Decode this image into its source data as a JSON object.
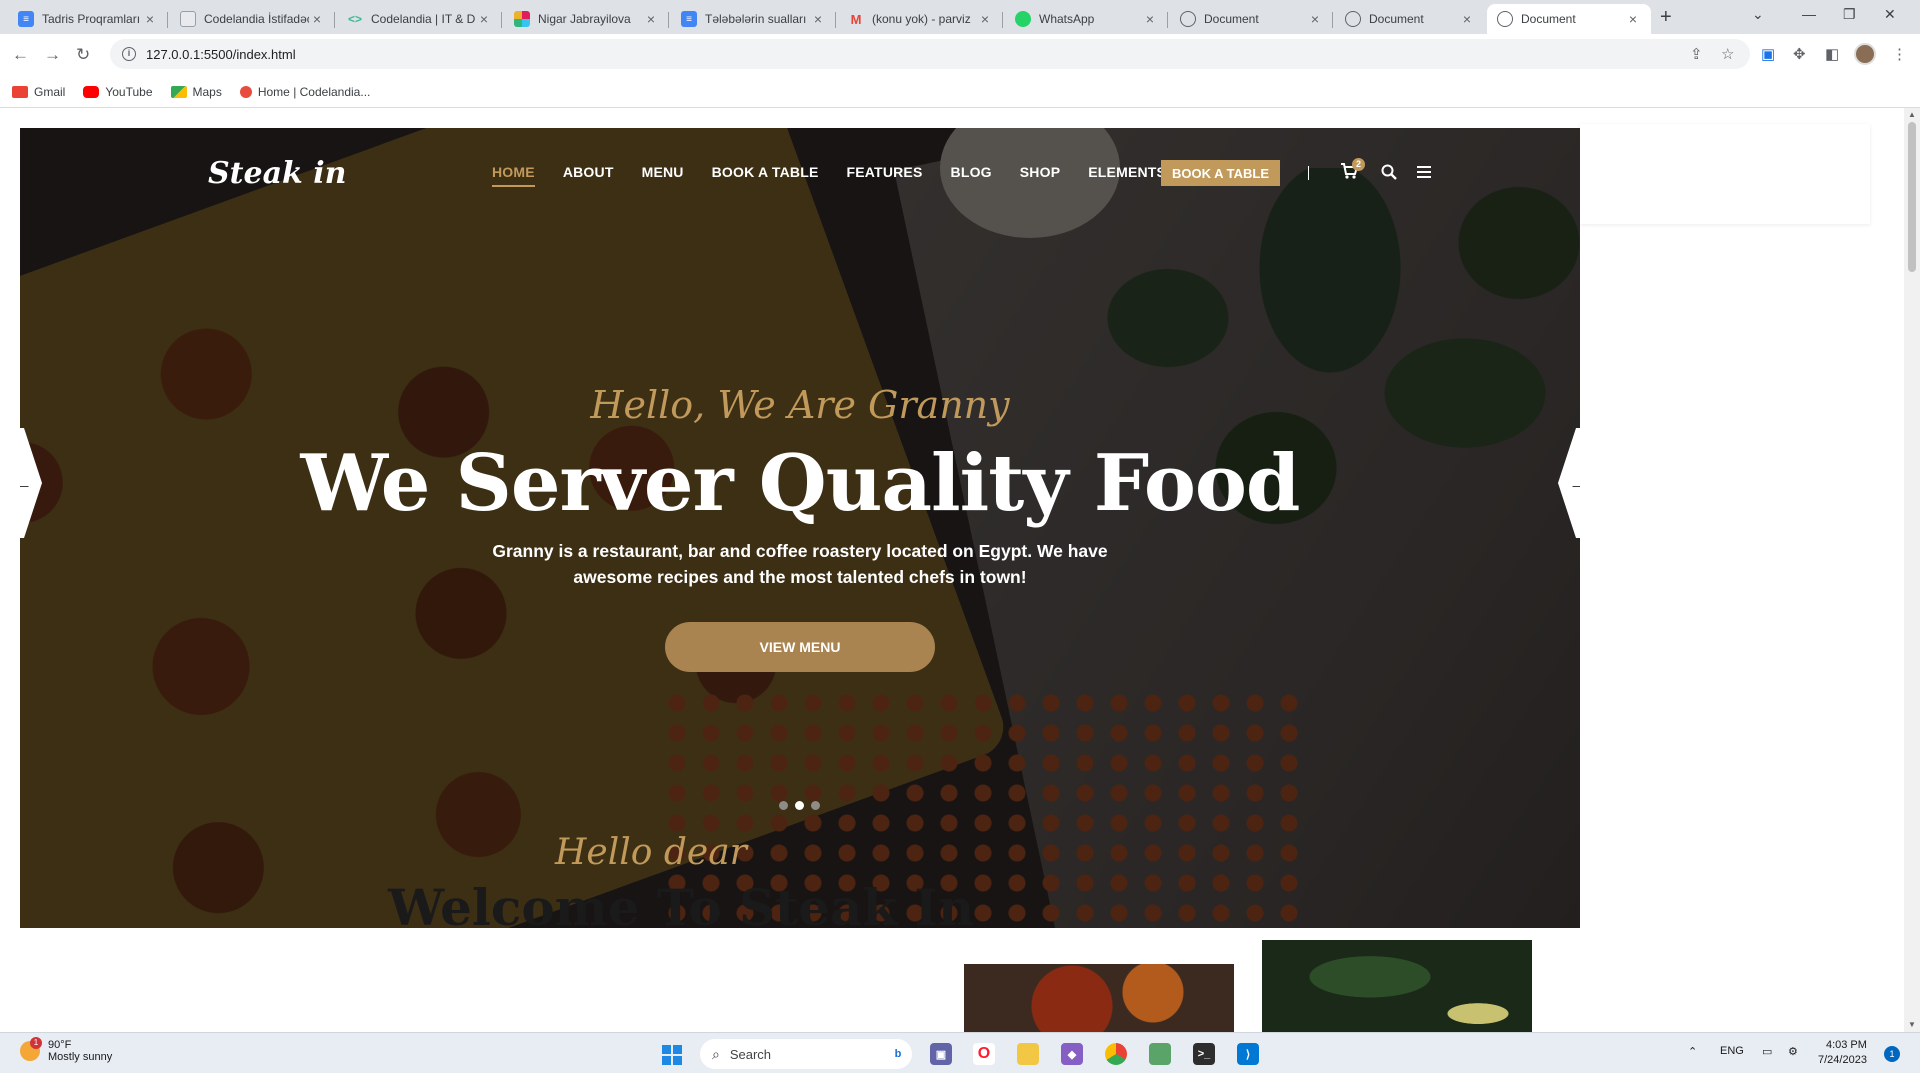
{
  "browser": {
    "tabs": [
      {
        "title": "Tadris Proqramları",
        "icon": "google-docs-icon",
        "color": "#4285f4"
      },
      {
        "title": "Codelandia İstifadəçi",
        "icon": "document-icon",
        "color": "#9aa0a6"
      },
      {
        "title": "Codelandia | IT & Dizayn",
        "icon": "code-icon",
        "color": "#3ab795"
      },
      {
        "title": "Nigar Jabrayilova",
        "icon": "slack-icon",
        "color": "#e01e5a"
      },
      {
        "title": "Tələbələrin sualları",
        "icon": "google-docs-icon",
        "color": "#4285f4"
      },
      {
        "title": "(konu yok) - parviz",
        "icon": "gmail-icon",
        "color": "#ea4335"
      },
      {
        "title": "WhatsApp",
        "icon": "whatsapp-icon",
        "color": "#25d366"
      },
      {
        "title": "Document",
        "icon": "globe-icon",
        "color": "#5f6368"
      },
      {
        "title": "Document",
        "icon": "globe-icon",
        "color": "#5f6368"
      },
      {
        "title": "Document",
        "icon": "globe-icon",
        "color": "#5f6368"
      }
    ],
    "active_tab_index": 9,
    "url": "127.0.0.1:5500/index.html",
    "bookmarks": [
      {
        "label": "Gmail",
        "color": "#ea4335"
      },
      {
        "label": "YouTube",
        "color": "#ff0000"
      },
      {
        "label": "Maps",
        "color": "#34a853"
      },
      {
        "label": "Home | Codelandia...",
        "color": "#e74c3c"
      }
    ]
  },
  "site": {
    "logo": "Steak in",
    "nav": [
      "HOME",
      "ABOUT",
      "MENU",
      "BOOK A TABLE",
      "FEATURES",
      "BLOG",
      "SHOP",
      "ELEMENTS"
    ],
    "nav_active": "HOME",
    "nav_cta": "BOOK A TABLE",
    "cart_count": "2",
    "accent": "#c19a5b",
    "hero": {
      "subtitle": "Hello, We Are Granny",
      "title": "We Server Quality Food",
      "description": "Granny is a restaurant, bar and coffee roastery located on Egypt. We have awesome recipes and the most talented chefs in town!",
      "button": "VIEW MENU",
      "slides": 3,
      "active_slide": 2
    },
    "welcome": {
      "subtitle": "Hello dear",
      "title": "Welcome To Steak In"
    }
  },
  "taskbar": {
    "weather_temp": "90°F",
    "weather_desc": "Mostly sunny",
    "weather_badge": "1",
    "search_placeholder": "Search",
    "language": "ENG",
    "time": "4:03 PM",
    "date": "7/24/2023",
    "notification_count": "1"
  }
}
